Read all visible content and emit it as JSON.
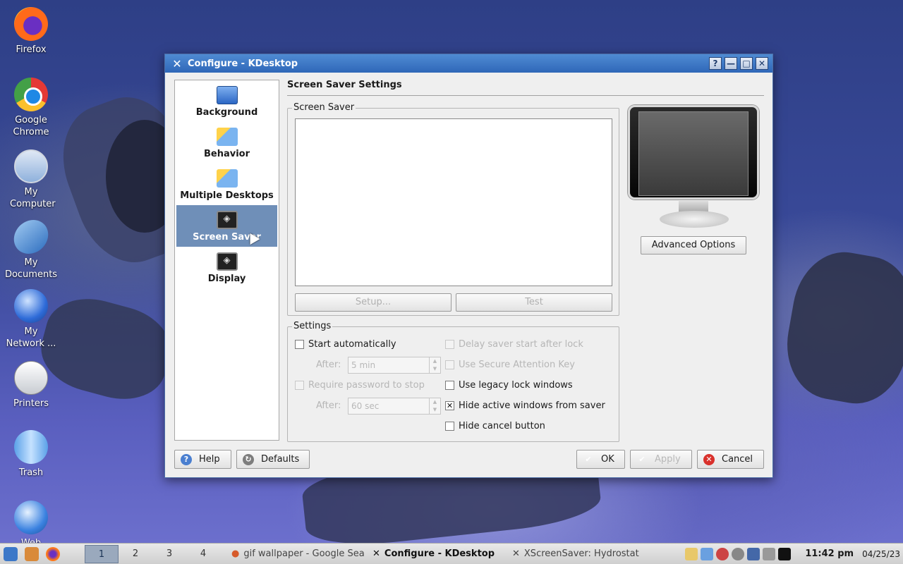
{
  "desktop": {
    "icons": [
      {
        "label": "Firefox"
      },
      {
        "label": "Google Chrome"
      },
      {
        "label": "My Computer"
      },
      {
        "label": "My Documents"
      },
      {
        "label": "My Network ..."
      },
      {
        "label": "Printers"
      },
      {
        "label": "Trash"
      },
      {
        "label": "Web"
      }
    ]
  },
  "window": {
    "title": "Configure - KDesktop",
    "controls": {
      "help": "?",
      "minimize": "—",
      "maximize": "□",
      "close": "✕"
    }
  },
  "sidebar": {
    "items": [
      {
        "label": "Background"
      },
      {
        "label": "Behavior"
      },
      {
        "label": "Multiple Desktops"
      },
      {
        "label": "Screen Saver"
      },
      {
        "label": "Display"
      }
    ],
    "selected": "Screen Saver"
  },
  "page": {
    "title": "Screen Saver Settings",
    "saver_group": {
      "legend": "Screen Saver",
      "setup_label": "Setup...",
      "test_label": "Test"
    },
    "advanced_label": "Advanced Options",
    "settings_group": {
      "legend": "Settings",
      "start_auto": "Start automatically",
      "start_auto_checked": false,
      "after_label": "After:",
      "after_value": "5 min",
      "require_password": "Require password to stop",
      "require_password_checked": false,
      "after2_label": "After:",
      "after2_value": "60 sec",
      "delay_saver": "Delay saver start after lock",
      "secure_key": "Use Secure Attention Key",
      "legacy_lock": "Use legacy lock windows",
      "legacy_lock_checked": false,
      "hide_active": "Hide active windows from saver",
      "hide_active_checked": true,
      "hide_cancel": "Hide cancel button",
      "hide_cancel_checked": false
    }
  },
  "buttons": {
    "help": "Help",
    "defaults": "Defaults",
    "ok": "OK",
    "apply": "Apply",
    "cancel": "Cancel"
  },
  "taskbar": {
    "desktops": [
      "1",
      "2",
      "3",
      "4"
    ],
    "active_desktop": "1",
    "tasks": [
      {
        "label": "gif wallpaper - Google Sea"
      },
      {
        "label": "Configure - KDesktop"
      },
      {
        "label": "XScreenSaver: Hydrostat"
      }
    ],
    "clock": "11:42 pm",
    "date": "04/25/23"
  },
  "colors": {
    "titlebar": "#2f67b8",
    "selected_nav": "#6f8fb8",
    "ok_check": "#2aa82a",
    "cancel_icon": "#d9312c"
  }
}
